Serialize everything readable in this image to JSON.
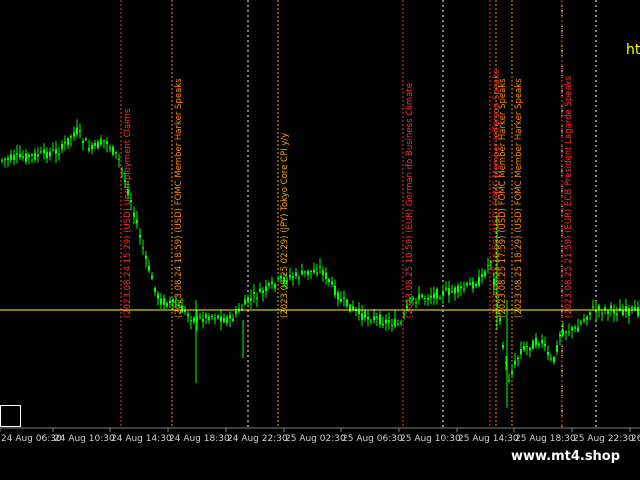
{
  "watermark": "www.mt4.shop",
  "corner_text": "ht",
  "colors": {
    "background": "#000000",
    "candle": "#00ff00",
    "price_line": "#ffff00",
    "event_usd": "#ff3030",
    "event_fomc": "#ff8c00",
    "event_jpy": "#ffa500",
    "event_eur": "#ff3030",
    "session_line": "#ffffff",
    "axis_text": "#cfcfcf"
  },
  "chart_data": {
    "type": "candlestick",
    "x_ticks": [
      "24 Aug 06:30",
      "24 Aug 10:30",
      "24 Aug 14:30",
      "24 Aug 18:30",
      "24 Aug 22:30",
      "25 Aug 02:30",
      "25 Aug 06:30",
      "25 Aug 10:30",
      "25 Aug 14:30",
      "25 Aug 18:30",
      "25 Aug 22:30",
      "26"
    ],
    "price_line": true,
    "events": [
      {
        "label": "(2023.08.24 15:29) (USD) Unemployment Claims",
        "currency": "USD"
      },
      {
        "label": "(2023.08.24 18:59) (USD) FOMC Member Harker Speaks",
        "currency": "USD-FOMC"
      },
      {
        "label": "(2023.08.25 02:29) (JPY) Tokyo Core CPI y/y",
        "currency": "JPY"
      },
      {
        "label": "(2023.08.25 10:59) (EUR) German ifo Business Climate",
        "currency": "EUR"
      },
      {
        "label": "(2023.08.25 16:59) (USD) FOMC Member Jefferson Speaks",
        "currency": "USD"
      },
      {
        "label": "(2023.08.25 17:59) (USD) FOMC Member Harker Speaks",
        "currency": "USD-FOMC"
      },
      {
        "label": "(2023.08.25 18:29) (USD) FOMC Member Harker Speaks",
        "currency": "USD-FOMC"
      },
      {
        "label": "(2023.08.25 21:59) (EUR) ECB President Lagarde Speaks",
        "currency": "EUR"
      }
    ]
  }
}
